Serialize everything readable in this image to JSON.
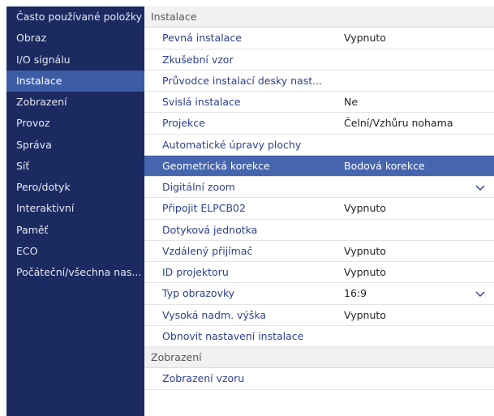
{
  "sidebar": {
    "items": [
      {
        "label": "Často používané položky",
        "active": false
      },
      {
        "label": "Obraz",
        "active": false
      },
      {
        "label": "I/O signálu",
        "active": false
      },
      {
        "label": "Instalace",
        "active": true
      },
      {
        "label": "Zobrazení",
        "active": false
      },
      {
        "label": "Provoz",
        "active": false
      },
      {
        "label": "Správa",
        "active": false
      },
      {
        "label": "Síť",
        "active": false
      },
      {
        "label": "Pero/dotyk",
        "active": false
      },
      {
        "label": "Interaktivní",
        "active": false
      },
      {
        "label": "Paměť",
        "active": false
      },
      {
        "label": "ECO",
        "active": false
      },
      {
        "label": "Počáteční/všechna nas...",
        "active": false
      }
    ]
  },
  "main": {
    "section_title": "Instalace",
    "rows": [
      {
        "label": "Pevná instalace",
        "value": "Vypnuto"
      },
      {
        "label": "Zkušební vzor",
        "value": ""
      },
      {
        "label": "Průvodce instalací desky nast...",
        "value": ""
      },
      {
        "label": "Svislá instalace",
        "value": "Ne"
      },
      {
        "label": "Projekce",
        "value": "Čelní/Vzhůru nohama"
      },
      {
        "label": "Automatické úpravy plochy",
        "value": ""
      },
      {
        "label": "Geometrická korekce",
        "value": "Bodová korekce",
        "selected": true
      },
      {
        "label": "Digitální zoom",
        "value": "",
        "chevron": "chevron-down-icon"
      },
      {
        "label": "Připojit ELPCB02",
        "value": "Vypnuto"
      },
      {
        "label": "Dotyková jednotka",
        "value": ""
      },
      {
        "label": "Vzdálený přijímač",
        "value": "Vypnuto"
      },
      {
        "label": "ID projektoru",
        "value": "Vypnuto"
      },
      {
        "label": "Typ obrazovky",
        "value": "16:9",
        "chevron": "chevron-down-icon"
      },
      {
        "label": "Vysoká nadm. výška",
        "value": "Vypnuto"
      },
      {
        "label": "Obnovit nastavení instalace",
        "value": ""
      }
    ],
    "next_section_title": "Zobrazení",
    "next_rows": [
      {
        "label": "Zobrazení vzoru",
        "value": ""
      }
    ]
  },
  "colors": {
    "sidebar_bg": "#1b2a61",
    "sidebar_active": "#3d5ca6",
    "row_selected": "#4565af",
    "label_text": "#2e3f8f"
  }
}
